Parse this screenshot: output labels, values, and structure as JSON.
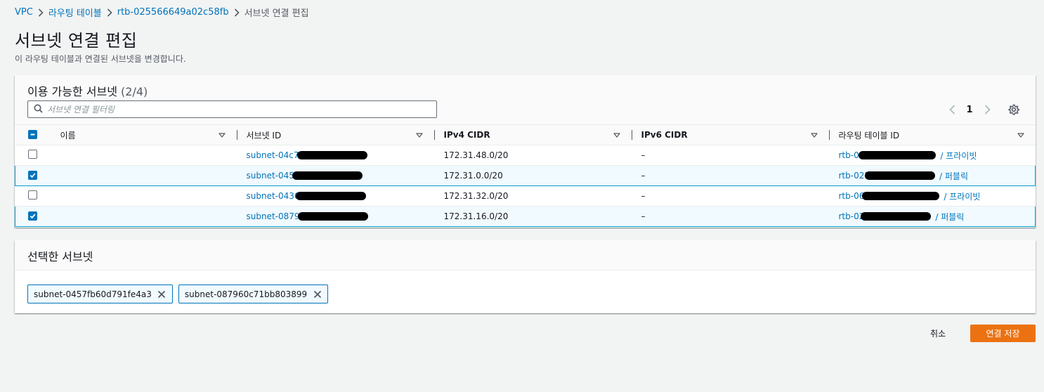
{
  "breadcrumb": {
    "items": [
      "VPC",
      "라우팅 테이블",
      "rtb-025566649a02c58fb"
    ],
    "current": "서브넷 연결 편집"
  },
  "page": {
    "title": "서브넷 연결 편집",
    "description": "이 라우팅 테이블과 연결된 서브넷을 변경합니다."
  },
  "subnets_panel": {
    "heading": "이용 가능한 서브넷",
    "count": "(2/4)",
    "filter_placeholder": "서브넷 연결 필터링",
    "page_number": "1",
    "columns": [
      "이름",
      "서브넷 ID",
      "IPv4 CIDR",
      "IPv6 CIDR",
      "라우팅 테이블 ID"
    ],
    "rows": [
      {
        "checked": false,
        "name": "",
        "subnet_id": "subnet-04c7740",
        "ipv4": "172.31.48.0/20",
        "ipv6": "–",
        "rtb_id": "rtb-06",
        "rtb_type": "/ 프라이빗"
      },
      {
        "checked": true,
        "name": "",
        "subnet_id": "subnet-045",
        "ipv4": "172.31.0.0/20",
        "ipv6": "–",
        "rtb_id": "rtb-025",
        "rtb_type": "/ 퍼블릭"
      },
      {
        "checked": false,
        "name": "",
        "subnet_id": "subnet-0436",
        "ipv4": "172.31.32.0/20",
        "ipv6": "–",
        "rtb_id": "rtb-06",
        "rtb_type": "/ 프라이빗"
      },
      {
        "checked": true,
        "name": "",
        "subnet_id": "subnet-0879",
        "ipv4": "172.31.16.0/20",
        "ipv6": "–",
        "rtb_id": "rtb-02",
        "rtb_type": "/ 퍼블릭"
      }
    ]
  },
  "selected_panel": {
    "heading": "선택한 서브넷",
    "tokens": [
      "subnet-0457fb60d791fe4a3",
      "subnet-087960c71bb803899"
    ]
  },
  "footer": {
    "cancel_label": "취소",
    "save_label": "연결 저장"
  },
  "colors": {
    "link": "#0073bb",
    "primary_button": "#ec7211",
    "selected_row_bg": "#f1faff",
    "selected_row_border": "#00a1c9",
    "background": "#f2f3f3"
  }
}
